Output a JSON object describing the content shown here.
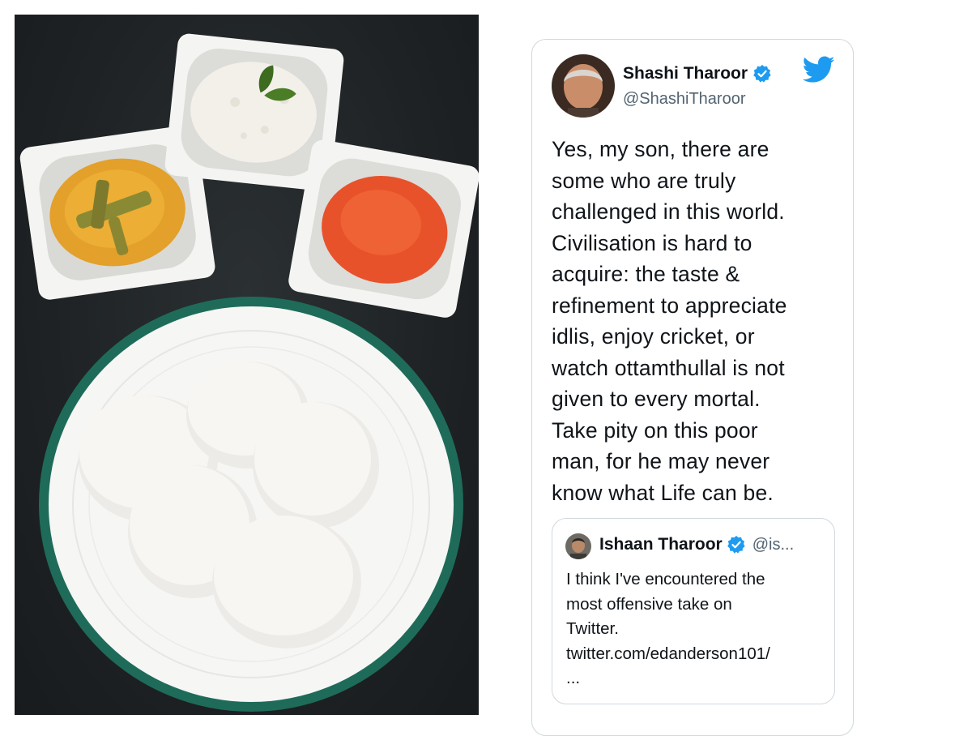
{
  "photo": {
    "subject": "idli-plate-with-chutneys",
    "background_color": "#1e2224",
    "plate_rim_color": "#1f6b5a"
  },
  "tweet": {
    "author_name": "Shashi Tharoor",
    "author_handle": "@ShashiTharoor",
    "verified_icon": "verified-badge-icon",
    "brand_icon": "twitter-bird-icon",
    "brand_color": "#1d9bf0",
    "text": "Yes, my son, there are\nsome who are truly\nchallenged in this world.\nCivilisation is hard to\nacquire: the taste &\nrefinement to appreciate\nidlis, enjoy cricket, or\nwatch ottamthullal is not\ngiven to every mortal.\nTake pity on this poor\nman, for he may never\nknow what Life can be.",
    "quoted": {
      "author_name": "Ishaan Tharoor",
      "author_handle": "@is...",
      "text": "I think I've encountered the\nmost offensive take on\nTwitter.\ntwitter.com/edanderson101/\n..."
    }
  }
}
